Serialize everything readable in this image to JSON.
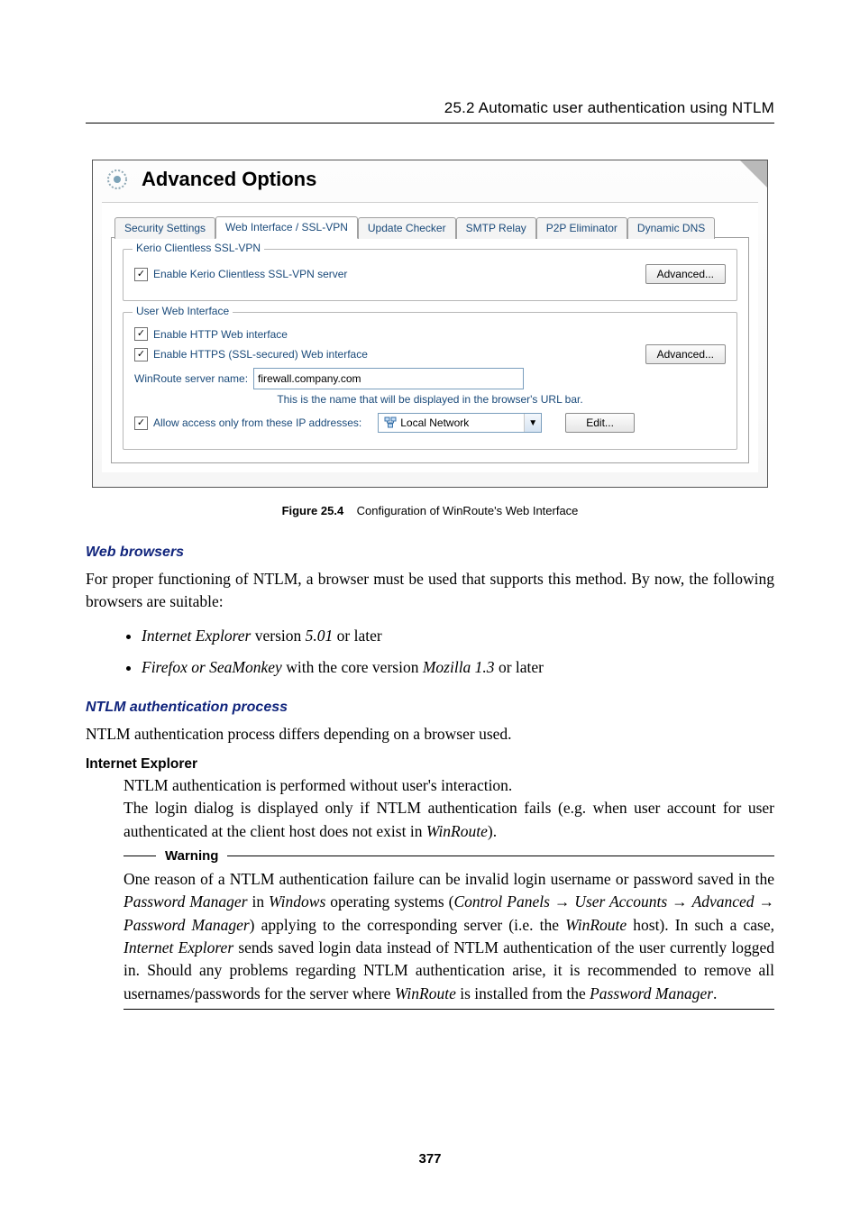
{
  "running_head": "25.2  Automatic user authentication using NTLM",
  "figure": {
    "title": "Advanced Options",
    "tabs": {
      "security": "Security Settings",
      "web": "Web Interface / SSL-VPN",
      "update": "Update Checker",
      "smtp": "SMTP Relay",
      "p2p": "P2P Eliminator",
      "ddns": "Dynamic DNS"
    },
    "group1": {
      "legend": "Kerio Clientless SSL-VPN",
      "enable": "Enable Kerio Clientless SSL-VPN server",
      "advanced": "Advanced..."
    },
    "group2": {
      "legend": "User Web Interface",
      "enable_http": "Enable HTTP Web interface",
      "enable_https": "Enable HTTPS (SSL-secured) Web interface",
      "advanced": "Advanced...",
      "server_label": "WinRoute server name:",
      "server_value": "firewall.company.com",
      "hint": "This is the name that will be displayed in the browser's URL bar.",
      "allow_label": "Allow access only from these IP addresses:",
      "combo_value": "Local Network",
      "edit": "Edit..."
    },
    "caption_bold": "Figure 25.4",
    "caption_rest": "Configuration of WinRoute's Web Interface"
  },
  "sec1": {
    "heading": "Web browsers",
    "p1": "For proper functioning of NTLM, a browser must be used that supports this method. By now, the following browsers are suitable:",
    "li1_em": "Internet Explorer",
    "li1_mid": " version ",
    "li1_em2": "5.01",
    "li1_tail": " or later",
    "li2_em": "Firefox or SeaMonkey",
    "li2_mid": " with the core version ",
    "li2_em2": "Mozilla 1.3",
    "li2_tail": " or later"
  },
  "sec2": {
    "heading": "NTLM authentication process",
    "p1": "NTLM authentication process differs depending on a browser used.",
    "sub1": "Internet Explorer",
    "s1_p1": "NTLM authentication is performed without user's interaction.",
    "s1_p2a": "The login dialog is displayed only if NTLM authentication fails (e.g. when user account for user authenticated at the client host does not exist in ",
    "s1_p2_em": "WinRoute",
    "s1_p2b": ").",
    "warning_label": "Warning",
    "warn_a": "One reason of a NTLM authentication failure can be invalid login username or password saved in the ",
    "warn_em1": "Password Manager",
    "warn_b": " in ",
    "warn_em2": "Windows",
    "warn_c": " operating systems (",
    "warn_em3": "Control Panels",
    "warn_arr1": " → ",
    "warn_em4": "User Accounts",
    "warn_arr2": " → ",
    "warn_em5": "Advanced",
    "warn_arr3": " → ",
    "warn_em6": "Password Manager",
    "warn_d": ") applying to the corresponding server (i.e. the ",
    "warn_em7": "WinRoute",
    "warn_e": " host).  In such a case, ",
    "warn_em8": "Internet Explorer",
    "warn_f": " sends saved login data instead of NTLM authentication of the user currently logged in.  Should any problems regarding NTLM authentication arise, it is recommended to remove all usernames/passwords for the server where ",
    "warn_em9": "WinRoute",
    "warn_g": " is installed from the ",
    "warn_em10": "Password Manager",
    "warn_h": "."
  },
  "page_number": "377"
}
